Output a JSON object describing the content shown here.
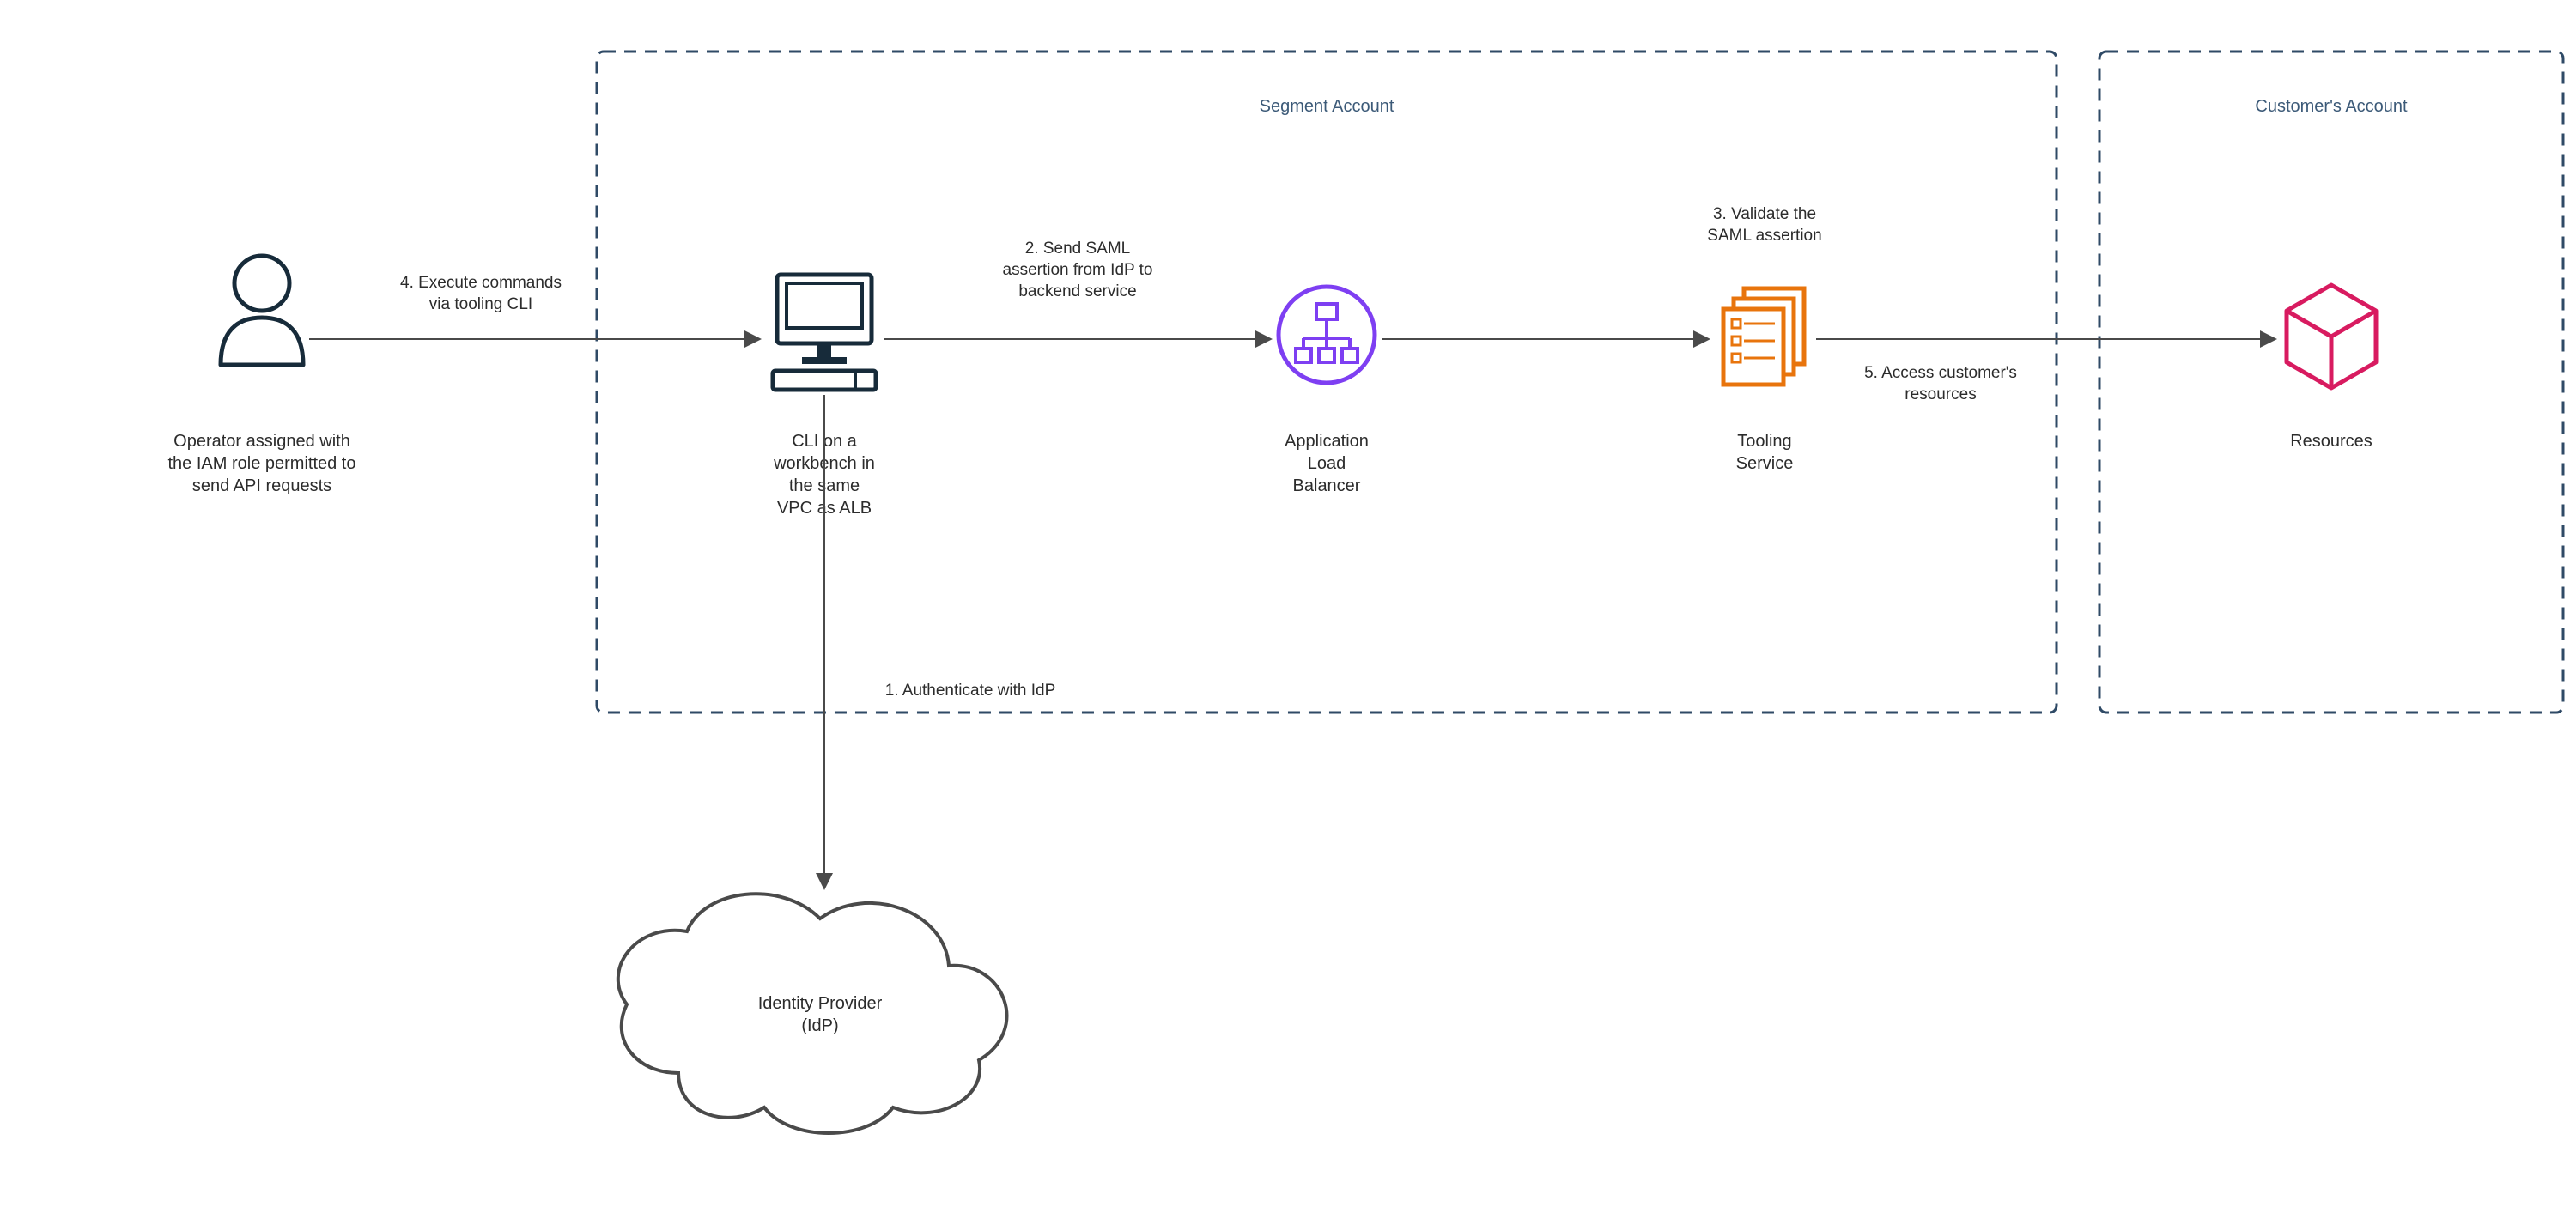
{
  "containers": {
    "segment_account": "Segment Account",
    "customer_account": "Customer's Account"
  },
  "nodes": {
    "operator_l1": "Operator assigned with",
    "operator_l2": "the IAM role permitted to",
    "operator_l3": "send API requests",
    "cli_l1": "CLI on a",
    "cli_l2": "workbench in",
    "cli_l3": "the same",
    "cli_l4": "VPC as ALB",
    "alb_l1": "Application",
    "alb_l2": "Load",
    "alb_l3": "Balancer",
    "tooling_l1": "Tooling",
    "tooling_l2": "Service",
    "resources": "Resources",
    "idp_l1": "Identity Provider",
    "idp_l2": "(IdP)"
  },
  "edges": {
    "step1": "1. Authenticate with IdP",
    "step2_l1": "2. Send SAML",
    "step2_l2": "assertion from IdP to",
    "step2_l3": "backend service",
    "step3_l1": "3. Validate the",
    "step3_l2": "SAML assertion",
    "step4_l1": "4. Execute commands",
    "step4_l2": "via tooling CLI",
    "step5_l1": "5. Access customer's",
    "step5_l2": "resources"
  },
  "colors": {
    "dashed_border": "#2f4a66",
    "alb_purple": "#7e3ff2",
    "tooling_orange": "#e8740c",
    "resources_magenta": "#d81b60",
    "icon_navy": "#172b3a",
    "text": "#2c2c2c"
  }
}
